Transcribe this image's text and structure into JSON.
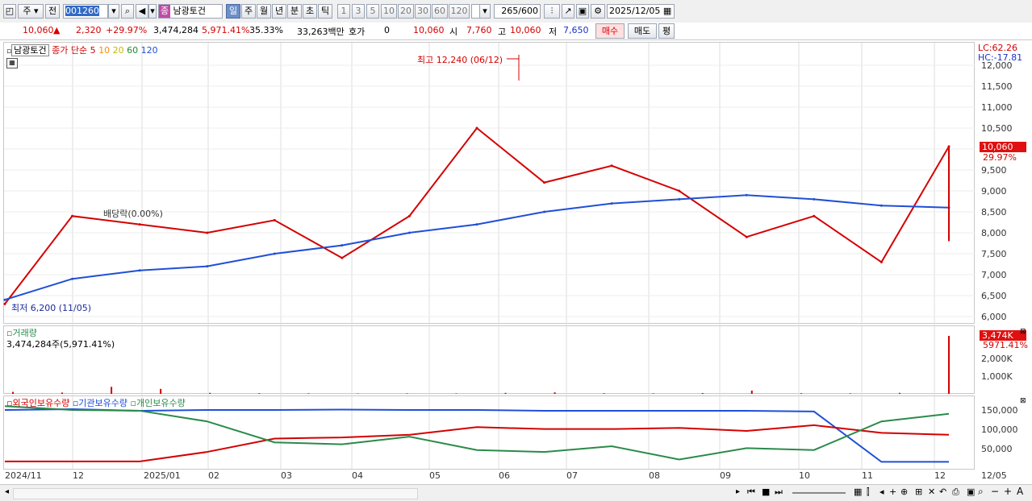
{
  "toolbar": {
    "period_label": "주",
    "prev_label": "전",
    "code_value": "001260",
    "name_badge": "종",
    "stock_name": "남광토건",
    "tf_buttons": [
      "일",
      "주",
      "월",
      "년",
      "분",
      "초",
      "틱"
    ],
    "num_buttons": [
      "1",
      "3",
      "5",
      "10",
      "20",
      "30",
      "60",
      "120"
    ],
    "count_value": "265",
    "count_total": "/600",
    "date_value": "2025/12/05"
  },
  "quote": {
    "price": "10,060",
    "change": "2,320",
    "change_pct": "+29.97%",
    "volume": "3,474,284",
    "volume_pct": "5,971.41%",
    "turnover_pct": "35.33%",
    "amount": "33,263백만",
    "hoga_label": "호가",
    "hoga_value": "0",
    "hoga_price": "10,060",
    "open_label": "시",
    "open_value": "7,760",
    "high_label": "고",
    "high_value": "10,060",
    "low_label": "저",
    "low_value": "7,650",
    "buy_label": "매수",
    "sell_label": "매도",
    "eval_label": "평"
  },
  "price_pane": {
    "stock_label": "남광토건",
    "series_label": "종가 단순",
    "ma_labels": [
      "5",
      "10",
      "20",
      "60",
      "120"
    ],
    "ma_colors": [
      "#d40000",
      "#ff8c00",
      "#e6d800",
      "#1f8f2f",
      "#1f4fd6"
    ],
    "lc_label": "LC:62.26",
    "hc_label": "HC:-17.81",
    "high_annotation": "최고 12,240 (06/12)",
    "low_annotation": "최저 6,200 (11/05)",
    "event_annotation": "배당락(0.00%)",
    "current_price_tag": "10,060",
    "current_pct_tag": "29.97%",
    "y_ticks": [
      "12,000",
      "11,500",
      "11,000",
      "10,500",
      "10,000",
      "9,500",
      "9,000",
      "8,500",
      "8,000",
      "7,500",
      "7,000",
      "6,500",
      "6,000"
    ]
  },
  "volume_pane": {
    "title": "거래량",
    "value_label": "3,474,284주(5,971.41%)",
    "tag_value": "3,474K",
    "tag_pct": "5971.41%",
    "y_ticks": [
      "2,000K",
      "1,000K"
    ]
  },
  "holding_pane": {
    "legend": [
      "외국인보유수량",
      "기관보유수량",
      "개인보유수량"
    ],
    "legend_colors": [
      "#d40000",
      "#1f4fd6",
      "#2a8a4a"
    ],
    "y_ticks": [
      "150,000",
      "100,000",
      "50,000"
    ]
  },
  "x_axis": {
    "labels": [
      "2024/11",
      "12",
      "2025/01",
      "02",
      "03",
      "04",
      "05",
      "06",
      "07",
      "08",
      "09",
      "10",
      "11",
      "12",
      "12/05"
    ]
  },
  "chart_data": {
    "type": "line",
    "title": "",
    "xlabel": "",
    "ylabel": "",
    "ylim": [
      6000,
      12000
    ],
    "x": [
      "2024/11",
      "12",
      "2025/01",
      "02",
      "03",
      "04",
      "05",
      "06",
      "07",
      "08",
      "09",
      "10",
      "11",
      "12",
      "12/05"
    ],
    "series": [
      {
        "name": "종가",
        "values": [
          6300,
          8400,
          8200,
          8000,
          8300,
          7400,
          8400,
          10500,
          9200,
          9600,
          9000,
          7900,
          8400,
          7300,
          10060
        ]
      },
      {
        "name": "120",
        "values": [
          6400,
          6900,
          7100,
          7200,
          7500,
          7700,
          8000,
          8200,
          8500,
          8700,
          8800,
          8900,
          8800,
          8650,
          8600
        ]
      }
    ]
  }
}
